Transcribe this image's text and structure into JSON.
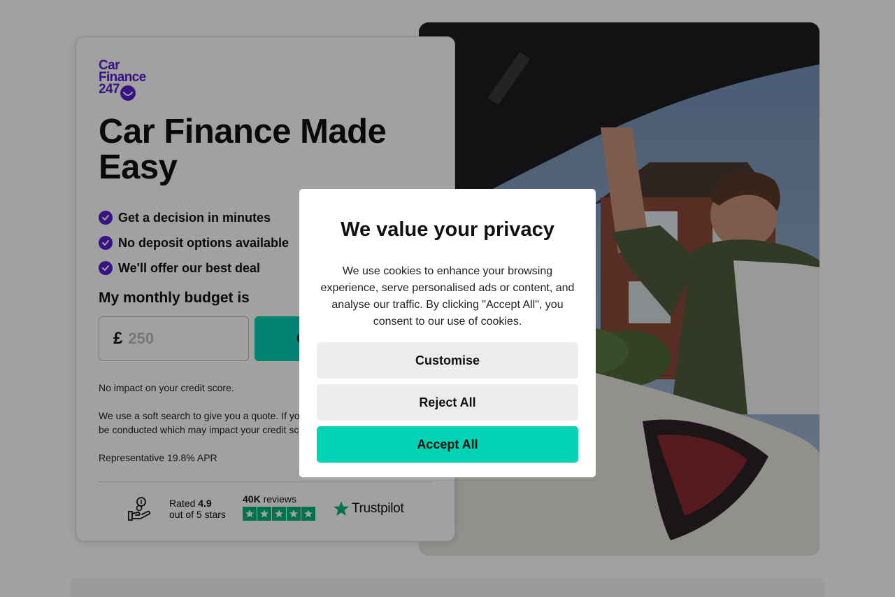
{
  "brand": {
    "logo_line1": "Car",
    "logo_line2": "Finance",
    "logo_line3": "247",
    "color": "#5b1fd2"
  },
  "hero": {
    "title": "Car Finance Made Easy",
    "benefits": [
      "Get a decision in minutes",
      "No deposit options available",
      "We'll offer our best deal"
    ]
  },
  "budget": {
    "label": "My monthly budget is",
    "currency": "£",
    "placeholder": "250",
    "button_label": "G"
  },
  "disclaimers": {
    "credit_score": "No impact on your credit score.",
    "soft_search": "We use a soft search to give you a quote. If yo\nbe conducted which may impact your credit sc",
    "apr": "Representative 19.8% APR"
  },
  "rating": {
    "rated_prefix": "Rated ",
    "score": "4.9",
    "out_of": "out of 5 stars",
    "reviews_count": "40K",
    "reviews_label": " reviews",
    "stars": 5,
    "provider": "Trustpilot",
    "star_color": "#00b67a"
  },
  "cookie_modal": {
    "title": "We value your privacy",
    "body": "We use cookies to enhance your browsing experience, serve personalised ads or content, and analyse our traffic. By clicking \"Accept All\", you consent to our use of cookies.",
    "customise_label": "Customise",
    "reject_label": "Reject All",
    "accept_label": "Accept All",
    "accent_color": "#00d2b4"
  }
}
